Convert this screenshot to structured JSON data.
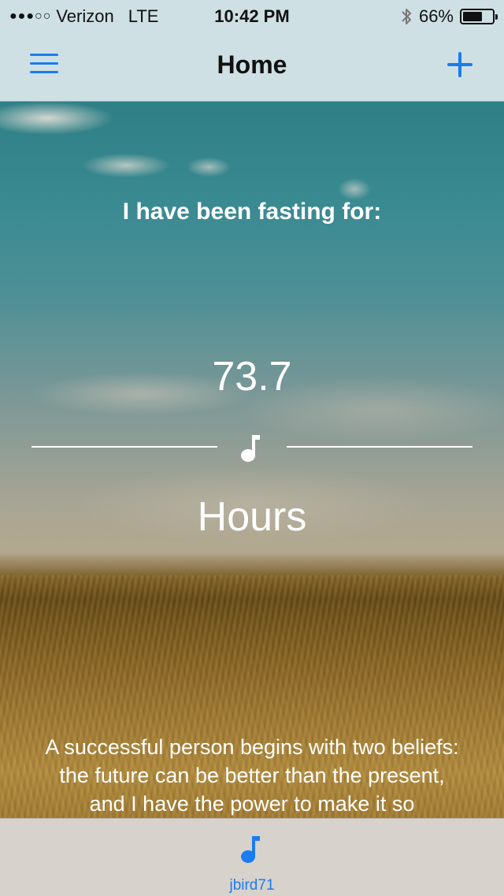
{
  "status_bar": {
    "signal": "●●●○○",
    "carrier": "Verizon",
    "network": "LTE",
    "time": "10:42 PM",
    "battery_percent": "66%",
    "battery_level": 0.66,
    "bluetooth_icon": "bluetooth-icon"
  },
  "nav": {
    "title": "Home",
    "menu_icon": "menu-icon",
    "add_icon": "plus-icon",
    "accent_color": "#1a7cf0"
  },
  "main": {
    "heading": "I have been fasting for:",
    "value": "73.7",
    "unit": "Hours",
    "divider_icon": "music-note-icon",
    "quote_lines": [
      "A successful person begins with two beliefs:",
      "the future can be better than the present,",
      "and I have the power to make it so"
    ]
  },
  "tab_bar": {
    "items": [
      {
        "label": "jbird71",
        "icon": "music-note-icon"
      }
    ]
  }
}
